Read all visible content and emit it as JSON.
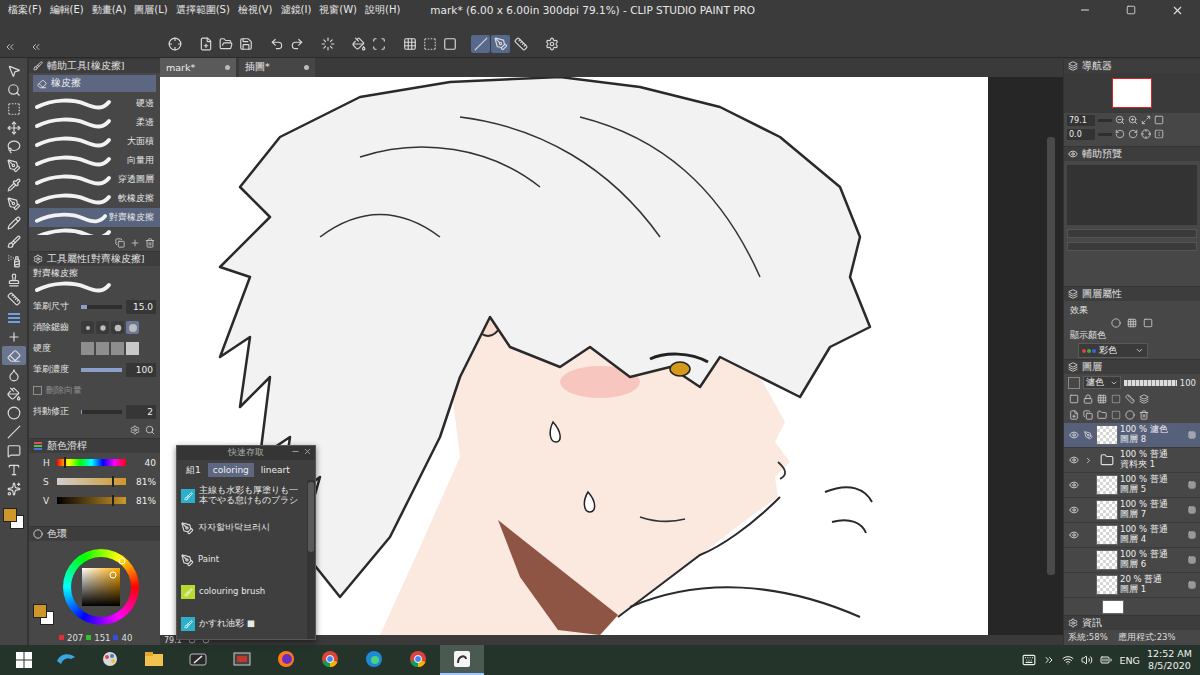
{
  "window": {
    "title": "mark* (6.00 x 6.00in 300dpi 79.1%)  - CLIP STUDIO PAINT PRO"
  },
  "menu": [
    "檔案(F)",
    "編輯(E)",
    "動畫(A)",
    "圖層(L)",
    "選擇範圍(S)",
    "檢視(V)",
    "濾鏡(I)",
    "視窗(W)",
    "說明(H)"
  ],
  "command_bar": {
    "buttons": [
      {
        "kind": "app",
        "selected": false
      },
      {
        "kind": "new",
        "selected": false
      },
      {
        "kind": "open",
        "selected": false
      },
      {
        "kind": "save",
        "selected": false
      },
      {
        "kind": "undo",
        "selected": false
      },
      {
        "kind": "redo",
        "selected": false
      },
      {
        "kind": "loader",
        "selected": false
      },
      {
        "kind": "fill",
        "selected": false
      },
      {
        "kind": "transform",
        "selected": false
      },
      {
        "kind": "grid",
        "selected": false
      },
      {
        "kind": "dashed",
        "selected": false
      },
      {
        "kind": "square",
        "selected": false
      },
      {
        "kind": "snap-ruler",
        "selected": true
      },
      {
        "kind": "snap-special",
        "selected": true
      },
      {
        "kind": "snap-grid",
        "selected": false
      },
      {
        "kind": "settings",
        "selected": false
      }
    ]
  },
  "tools": [
    {
      "kind": "pointer",
      "selected": false
    },
    {
      "kind": "zoom",
      "selected": false
    },
    {
      "kind": "select-circle",
      "selected": false
    },
    {
      "kind": "move",
      "selected": false
    },
    {
      "kind": "lasso",
      "selected": false
    },
    {
      "kind": "pen-tool",
      "selected": false
    },
    {
      "kind": "pipette",
      "selected": false
    },
    {
      "kind": "pen",
      "selected": false
    },
    {
      "kind": "pencil",
      "selected": false
    },
    {
      "kind": "brush",
      "selected": false
    },
    {
      "kind": "spray",
      "selected": false
    },
    {
      "kind": "decoration",
      "selected": false
    },
    {
      "kind": "ruler",
      "selected": false
    },
    {
      "kind": "gradient",
      "selected": false
    },
    {
      "kind": "text-plus",
      "selected": false
    },
    {
      "kind": "eraser",
      "selected": true
    },
    {
      "kind": "blend",
      "selected": false
    },
    {
      "kind": "fill",
      "selected": false
    },
    {
      "kind": "figure",
      "selected": false
    },
    {
      "kind": "line",
      "selected": false
    },
    {
      "kind": "balloon",
      "selected": false
    },
    {
      "kind": "text",
      "selected": false
    },
    {
      "kind": "correct",
      "selected": false
    }
  ],
  "swatches": [
    {
      "name": "main",
      "color": "#cf9728",
      "selected": true
    },
    {
      "name": "sub",
      "color": "#ffffff",
      "selected": false
    }
  ],
  "sub_tool": {
    "title": "輔助工具[橡皮擦]",
    "group": {
      "label": "橡皮擦",
      "selected": true
    },
    "items": [
      {
        "label": "硬邊",
        "selected": false
      },
      {
        "label": "柔邊",
        "selected": false
      },
      {
        "label": "大面積",
        "selected": false
      },
      {
        "label": "向量用",
        "selected": false
      },
      {
        "label": "穿透圖層",
        "selected": false
      },
      {
        "label": "軟橡皮擦",
        "selected": false
      },
      {
        "label": "對齊橡皮擦",
        "selected": true
      }
    ]
  },
  "tool_property": {
    "title": "工具屬性[對齊橡皮擦]",
    "tool": "對齊橡皮擦",
    "rows": [
      {
        "kind": "size",
        "label": "筆刷尺寸",
        "value": "15.0",
        "level": 0.15
      },
      {
        "kind": "circles",
        "label": "消除鋸齒",
        "options": [
          {
            "selected": false
          },
          {
            "selected": false
          },
          {
            "selected": false
          },
          {
            "selected": true
          }
        ]
      },
      {
        "kind": "squares",
        "label": "硬度",
        "options": [
          {
            "selected": false
          },
          {
            "selected": false
          },
          {
            "selected": false
          },
          {
            "selected": true
          }
        ]
      },
      {
        "kind": "value",
        "label": "筆刷濃度",
        "value": "100",
        "level": 1
      },
      {
        "kind": "check",
        "label": "刪除向量",
        "checked": false,
        "disabled": true
      },
      {
        "kind": "value",
        "label": "抖動修正",
        "value": "2",
        "level": 0.02
      }
    ]
  },
  "color_slider": {
    "title": "顏色滑桿",
    "channels": [
      {
        "label": "H",
        "value": "40",
        "level": 0.11
      },
      {
        "label": "S",
        "value": "81%",
        "level": 0.81
      },
      {
        "label": "V",
        "value": "81%",
        "level": 0.81
      }
    ]
  },
  "color_wheel": {
    "title": "色環",
    "rgb": [
      "207",
      "151",
      "40"
    ]
  },
  "document_tabs": [
    {
      "label": "mark*",
      "selected": true
    },
    {
      "label": "插圖*",
      "selected": false
    }
  ],
  "status": {
    "zoom": "79.1"
  },
  "quick_access": {
    "title": "快速存取",
    "tabs": [
      {
        "label": "組1",
        "selected": false
      },
      {
        "label": "coloring",
        "selected": true
      },
      {
        "label": "lineart",
        "selected": false
      }
    ],
    "items": [
      {
        "kind": "swatch",
        "label": "主線も水彩も厚塗りも一本でやる怠けものブラシ",
        "color": "#2ab0c8"
      },
      {
        "kind": "pen",
        "label": "자자할바닥브러시"
      },
      {
        "kind": "pen",
        "label": "Paint"
      },
      {
        "kind": "swatch",
        "label": "colouring brush",
        "color": "#b8d832"
      },
      {
        "kind": "swatch",
        "label": "かすれ油彩 ■",
        "color": "#2ab0c8"
      }
    ]
  },
  "navigator": {
    "title": "導航器",
    "zoom": "79.1",
    "angle": "0.0"
  },
  "sub_preview": {
    "title": "輔助預覽"
  },
  "layer_property": {
    "title": "圖層屬性",
    "effect_label": "效果",
    "display_color_label": "顯示顏色",
    "display_color": "彩色"
  },
  "layers": {
    "title": "圖層",
    "blend": "濾色",
    "opacity": "100",
    "opacity_level": 1,
    "items": [
      {
        "kind": "layer",
        "mode": "100 % 濾色",
        "name": "圖層 8",
        "visible": true,
        "selected": true
      },
      {
        "kind": "folder",
        "mode": "100 % 普通",
        "name": "資料夾 1",
        "visible": true,
        "selected": false
      },
      {
        "kind": "layer",
        "mode": "100 % 普通",
        "name": "圖層 5",
        "visible": true,
        "selected": false
      },
      {
        "kind": "layer",
        "mode": "100 % 普通",
        "name": "圖層 7",
        "visible": true,
        "selected": false
      },
      {
        "kind": "layer",
        "mode": "100 % 普通",
        "name": "圖層 4",
        "visible": true,
        "selected": false
      },
      {
        "kind": "layer",
        "mode": "100 % 普通",
        "name": "圖層 6",
        "visible": false,
        "selected": false
      },
      {
        "kind": "layer",
        "mode": "20 % 普通",
        "name": "圖層 1",
        "visible": false,
        "selected": false
      }
    ]
  },
  "info": {
    "title": "資訊",
    "system": "系統:58%",
    "app": "應用程式:23%"
  },
  "taskbar": {
    "apps": [
      {
        "kind": "dolphin",
        "selected": false
      },
      {
        "kind": "paint",
        "selected": false
      },
      {
        "kind": "explorer",
        "selected": false
      },
      {
        "kind": "tablet",
        "selected": false
      },
      {
        "kind": "tool",
        "selected": false
      },
      {
        "kind": "firefox",
        "selected": false
      },
      {
        "kind": "chrome",
        "selected": false
      },
      {
        "kind": "edge",
        "selected": false
      },
      {
        "kind": "chrome",
        "selected": false
      },
      {
        "kind": "csp",
        "selected": true
      }
    ],
    "language": "ENG",
    "time": "12:52 AM",
    "date": "8/5/2020"
  }
}
